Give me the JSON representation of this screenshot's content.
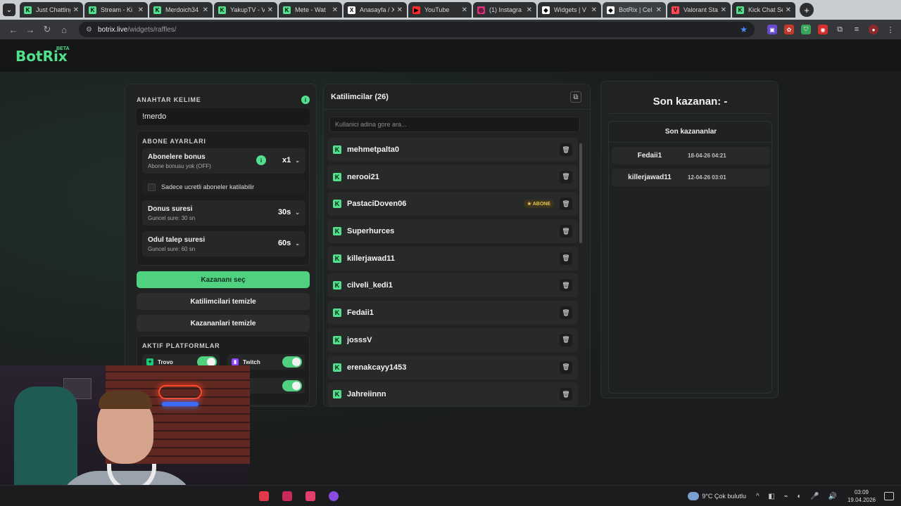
{
  "browser": {
    "tabs": [
      {
        "label": "Just Chatting",
        "fav_color": "#53e08c",
        "fav_glyph": "K"
      },
      {
        "label": "Stream - Ki",
        "fav_color": "#53e08c",
        "fav_glyph": "K"
      },
      {
        "label": "Merdoich34",
        "fav_color": "#53e08c",
        "fav_glyph": "K"
      },
      {
        "label": "YakupTV - V",
        "fav_color": "#53e08c",
        "fav_glyph": "K"
      },
      {
        "label": "Mete - Wat",
        "fav_color": "#53e08c",
        "fav_glyph": "K"
      },
      {
        "label": "Anasayfa / X",
        "fav_color": "#ffffff",
        "fav_glyph": "X"
      },
      {
        "label": "YouTube",
        "fav_color": "#ff2b2b",
        "fav_glyph": "▶"
      },
      {
        "label": "(1) Instagra",
        "fav_color": "#d6337a",
        "fav_glyph": "◎"
      },
      {
        "label": "Widgets | V",
        "fav_color": "#ffffff",
        "fav_glyph": "◆"
      },
      {
        "label": "BotRix | Cel",
        "fav_color": "#ffffff",
        "fav_glyph": "◆",
        "active": true
      },
      {
        "label": "Valorant Sta",
        "fav_color": "#ff4655",
        "fav_glyph": "V"
      },
      {
        "label": "Kick Chat Se",
        "fav_color": "#53e08c",
        "fav_glyph": "K"
      }
    ],
    "url_host": "botrix.live",
    "url_path": "/widgets/raffles/"
  },
  "app": {
    "logo": "BotRix",
    "beta": "BETA"
  },
  "keyword": {
    "label": "ANAHTAR KELIME",
    "value": "!merdo"
  },
  "subscriber": {
    "section_label": "ABONE AYARLARI",
    "bonus_title": "Abonelere bonus",
    "bonus_sub": "Abone bonusu yok (OFF)",
    "bonus_value": "x1",
    "only_paid_label": "Sadece ucretli aboneler katilabilir",
    "duration_title": "Donus suresi",
    "duration_sub": "Guncel sure: 30 sn",
    "duration_value": "30s",
    "claim_title": "Odul talep suresi",
    "claim_sub": "Guncel sure: 60 sn",
    "claim_value": "60s"
  },
  "buttons": {
    "pick_winner": "Kazananı seç",
    "clear_participants": "Katilimcilari temizle",
    "clear_winners": "Kazananlari temizle"
  },
  "platforms": {
    "section_label": "AKTIF PLATFORMLAR",
    "trovo": "Trovo",
    "twitch": "Twitch"
  },
  "participants": {
    "title": "Katilimcilar (26)",
    "search_placeholder": "Kullanici adina gore ara...",
    "subscriber_badge": "ABONE",
    "list": [
      {
        "name": "mehmetpalta0"
      },
      {
        "name": "nerooi21"
      },
      {
        "name": "PastaciDoven06",
        "subscriber": true
      },
      {
        "name": "Superhurces"
      },
      {
        "name": "killerjawad11"
      },
      {
        "name": "cilveli_kedi1"
      },
      {
        "name": "Fedaii1"
      },
      {
        "name": "josssV"
      },
      {
        "name": "erenakcayy1453"
      },
      {
        "name": "Jahreiinnn"
      }
    ]
  },
  "winner": {
    "title": "Son kazanan: -",
    "last_winners_title": "Son kazananlar",
    "last_winners": [
      {
        "name": "Fedaii1",
        "date": "18-04-26 04:21"
      },
      {
        "name": "killerjawad11",
        "date": "12-04-26 03:01"
      }
    ]
  },
  "taskbar": {
    "weather": "9°C  Çok bulutlu",
    "time": "03:09",
    "date": "19.04.2026"
  }
}
